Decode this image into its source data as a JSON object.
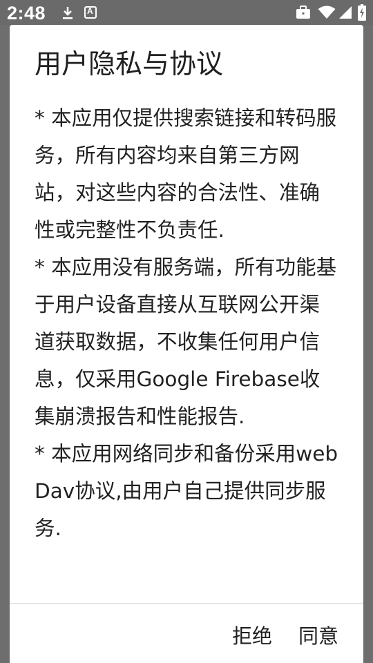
{
  "status_bar": {
    "time": "2:48",
    "icons": [
      "download-icon",
      "notification-a-icon",
      "briefcase-icon",
      "wifi-icon",
      "signal-icon",
      "battery-charging-icon"
    ],
    "notification_letter": "A"
  },
  "dialog": {
    "title": "用户隐私与协议",
    "paragraphs": [
      "* 本应用仅提供搜索链接和转码服务，所有内容均来自第三方网站，对这些内容的合法性、准确性或完整性不负责任.",
      "* 本应用没有服务端，所有功能基于用户设备直接从互联网公开渠道获取数据，不收集任何用户信息，仅采用Google Firebase收集崩溃报告和性能报告.",
      "* 本应用网络同步和备份采用webDav协议,由用户自己提供同步服务."
    ],
    "actions": {
      "reject_label": "拒绝",
      "agree_label": "同意"
    }
  },
  "colors": {
    "background_scrim": "#6e6e6e",
    "dialog_background": "#ffffff",
    "text_primary": "#202020",
    "divider": "#d8d8d8"
  }
}
